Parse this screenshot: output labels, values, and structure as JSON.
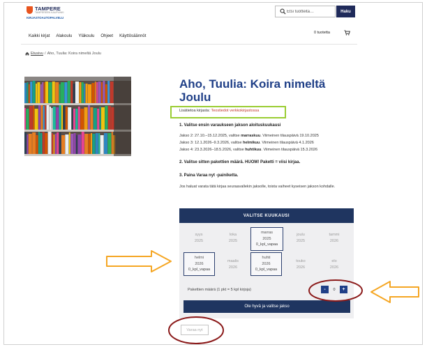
{
  "header": {
    "logo_title": "TAMPERE",
    "logo_subtitle": "TAMPEREEN KAUPUNKI",
    "logo_service": "KIRJASTOAUTOPALVELU",
    "search_placeholder": "Etsi tuotteita…",
    "search_button": "Haku",
    "cart_count": "0 tuotetta"
  },
  "nav": {
    "items": [
      "Kaikki kirjat",
      "Alakoulu",
      "Yläkoulu",
      "Ohjeet",
      "Käyttösäännöt"
    ]
  },
  "breadcrumb": {
    "home": "Etusivu",
    "separator": "/",
    "current": "Aho, Tuulia: Koira nimeltä Joulu"
  },
  "product": {
    "title": "Aho, Tuulia: Koira nimeltä Joulu",
    "library_label": "Lisätietoa kirjasta:",
    "library_link": "Teostiedot verkkokirjastossa",
    "step1": "1. Valitse ensin varaukseen jakson aloituskuukausi",
    "periods": [
      {
        "prefix": "Jakso 2: 27.10.–15.12.2025, valitse ",
        "month": "marraskuu",
        "suffix": ". Viimeinen tilauspäivä 19.10.2025"
      },
      {
        "prefix": "Jakso 3: 12.1.2026–9.3.2026, valitse ",
        "month": "helmikuu",
        "suffix": ". Viimeinen tilauspäivä 4.1.2026"
      },
      {
        "prefix": "Jakso 4: 23.3.2026–18.5.2026, valitse ",
        "month": "huhtikuu",
        "suffix": ". Viimeinen tilauspäivä 15.3.2026"
      }
    ],
    "step2_prefix": "2. Valitse sitten pakettien määrä. HUOM! Paketti = viisi kirjaa.",
    "step3": "3. Paina Varaa nyt -painiketta.",
    "note": "Jos haluat varata tätä kirjaa seuraavallekin jaksolle, toista vaiheet kyseisen jakson kohdalle."
  },
  "month_panel": {
    "header": "VALITSE KUUKAUSI",
    "months": [
      {
        "name": "syys",
        "year": "2025",
        "status": ""
      },
      {
        "name": "loka",
        "year": "2025",
        "status": ""
      },
      {
        "name": "marras",
        "year": "2025",
        "status": "0_kpl_vapaa"
      },
      {
        "name": "joulu",
        "year": "2025",
        "status": ""
      },
      {
        "name": "tammi",
        "year": "2026",
        "status": ""
      },
      {
        "name": "helmi",
        "year": "2026",
        "status": "0_kpl_vapaa"
      },
      {
        "name": "maalis",
        "year": "2026",
        "status": ""
      },
      {
        "name": "huhti",
        "year": "2026",
        "status": "0_kpl_vapaa"
      },
      {
        "name": "touko",
        "year": "2026",
        "status": ""
      },
      {
        "name": "elo",
        "year": "2026",
        "status": ""
      }
    ],
    "qty_label": "Pakettien määrä (1 pkt = 5 kpl kirjoja)",
    "qty_minus": "-",
    "qty_value": "0",
    "qty_plus": "+",
    "select_button": "Ole hyvä ja valitse jakso"
  },
  "reserve_button": "Varaa nyt",
  "colors": {
    "brand_navy": "#1f3560",
    "title_blue": "#1f3f87",
    "annotation_orange": "#f5a623",
    "annotation_red": "#8b1a1a",
    "highlight_green": "#9acd32",
    "logo_orange": "#e8541e"
  }
}
